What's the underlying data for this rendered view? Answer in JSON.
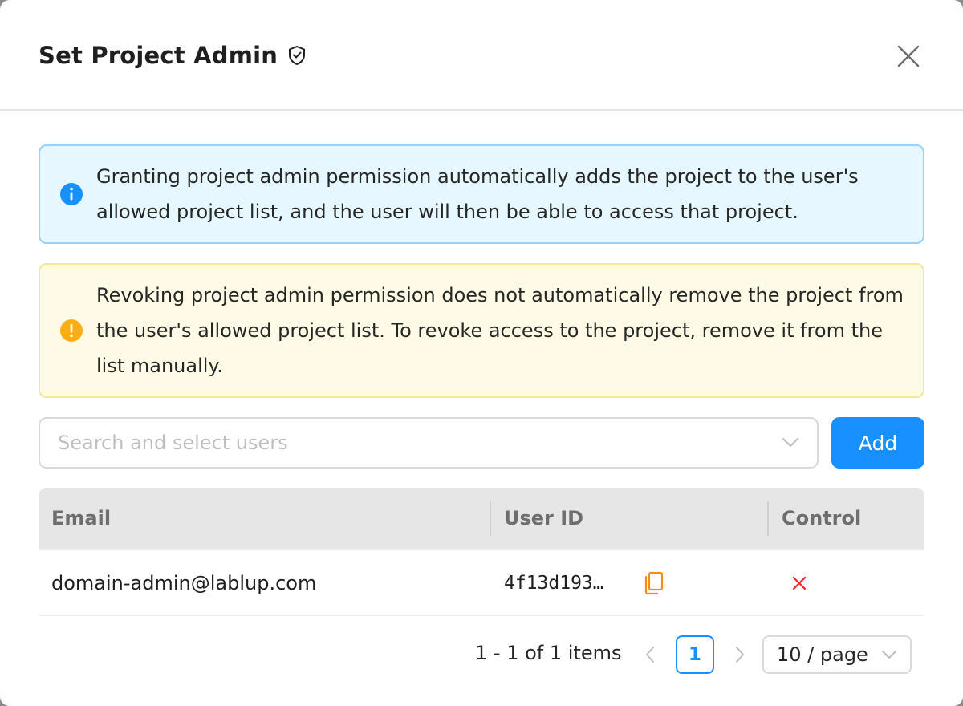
{
  "dialog": {
    "title": "Set Project Admin",
    "title_icon": "shield-check-icon",
    "close_icon": "close-icon"
  },
  "alerts": {
    "info": {
      "icon": "info-circle-icon",
      "color": "#1890ff",
      "text": "Granting project admin permission automatically adds the project to the user's allowed project list, and the user will then be able to access that project."
    },
    "warning": {
      "icon": "exclamation-circle-icon",
      "color": "#faad14",
      "text": "Revoking project admin permission does not automatically remove the project from the user's allowed project list. To revoke access to the project, remove it from the list manually."
    }
  },
  "user_select": {
    "placeholder": "Search and select users",
    "icon": "chevron-down-icon"
  },
  "add_button": {
    "label": "Add",
    "color": "#1890ff"
  },
  "table": {
    "columns": [
      "Email",
      "User ID",
      "Control"
    ],
    "rows": [
      {
        "email": "domain-admin@lablup.com",
        "user_id": "4f13d193…",
        "copy_icon": "copy-icon",
        "remove_icon": "close-icon"
      }
    ]
  },
  "pagination": {
    "total_text": "1 - 1 of 1 items",
    "current_page": "1",
    "page_size": "10 / page",
    "prev_icon": "chevron-left-icon",
    "next_icon": "chevron-right-icon"
  }
}
